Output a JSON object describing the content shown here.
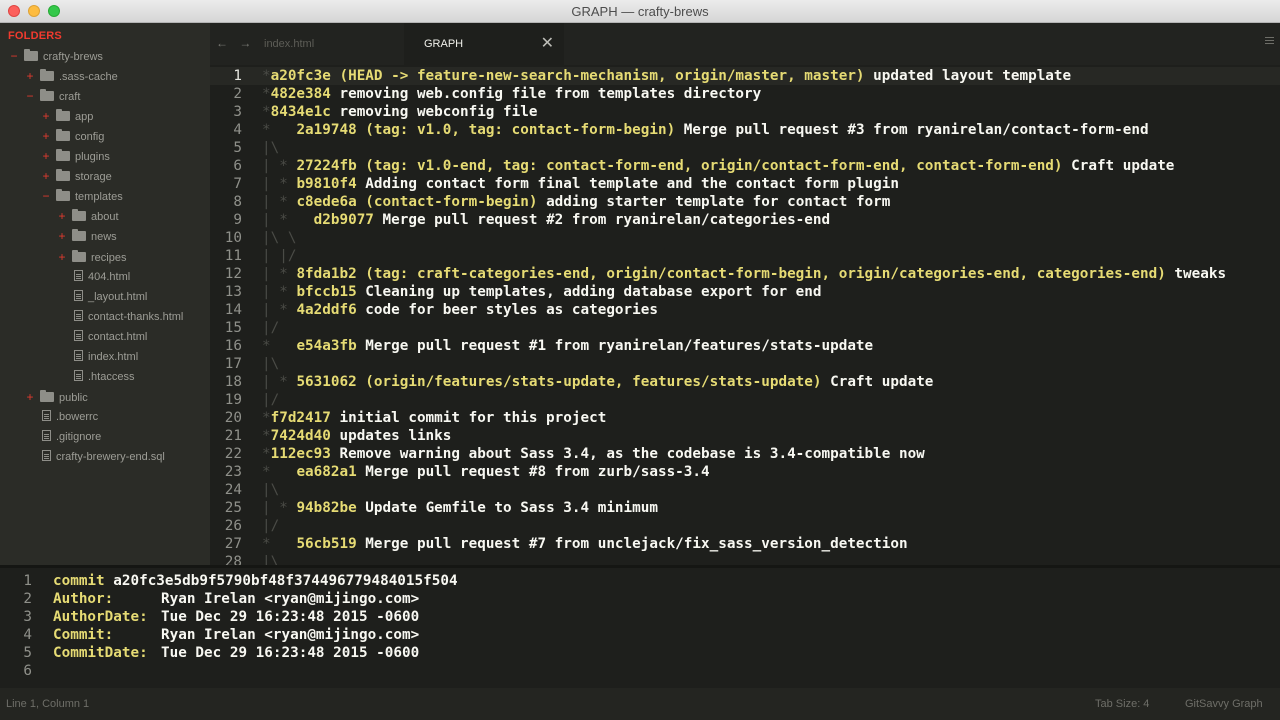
{
  "window": {
    "title": "GRAPH — crafty-brews"
  },
  "sidebar": {
    "header": "FOLDERS",
    "items": [
      {
        "label": "crafty-brews",
        "type": "folder",
        "toggle": "−",
        "depth": 0
      },
      {
        "label": ".sass-cache",
        "type": "folder",
        "toggle": "+",
        "depth": 1
      },
      {
        "label": "craft",
        "type": "folder",
        "toggle": "−",
        "depth": 1
      },
      {
        "label": "app",
        "type": "folder",
        "toggle": "+",
        "depth": 2
      },
      {
        "label": "config",
        "type": "folder",
        "toggle": "+",
        "depth": 2
      },
      {
        "label": "plugins",
        "type": "folder",
        "toggle": "+",
        "depth": 2
      },
      {
        "label": "storage",
        "type": "folder",
        "toggle": "+",
        "depth": 2
      },
      {
        "label": "templates",
        "type": "folder",
        "toggle": "−",
        "depth": 2
      },
      {
        "label": "about",
        "type": "folder",
        "toggle": "+",
        "depth": 3
      },
      {
        "label": "news",
        "type": "folder",
        "toggle": "+",
        "depth": 3
      },
      {
        "label": "recipes",
        "type": "folder",
        "toggle": "+",
        "depth": 3
      },
      {
        "label": "404.html",
        "type": "file",
        "toggle": "",
        "depth": 3
      },
      {
        "label": "_layout.html",
        "type": "file",
        "toggle": "",
        "depth": 3
      },
      {
        "label": "contact-thanks.html",
        "type": "file",
        "toggle": "",
        "depth": 3
      },
      {
        "label": "contact.html",
        "type": "file",
        "toggle": "",
        "depth": 3
      },
      {
        "label": "index.html",
        "type": "file",
        "toggle": "",
        "depth": 3
      },
      {
        "label": ".htaccess",
        "type": "file",
        "toggle": "",
        "depth": 3
      },
      {
        "label": "public",
        "type": "folder",
        "toggle": "+",
        "depth": 1
      },
      {
        "label": ".bowerrc",
        "type": "file",
        "toggle": "",
        "depth": 1
      },
      {
        "label": ".gitignore",
        "type": "file",
        "toggle": "",
        "depth": 1
      },
      {
        "label": "crafty-brewery-end.sql",
        "type": "file",
        "toggle": "",
        "depth": 1
      }
    ]
  },
  "tabs": {
    "nav_arrows": "← →",
    "items": [
      {
        "label": "index.html",
        "active": false
      },
      {
        "label": "GRAPH",
        "active": true
      }
    ],
    "close_glyph": "✕"
  },
  "editor": {
    "current_line": 1,
    "lines": [
      {
        "n": "1",
        "graph": "*",
        "hash": "a20fc3e",
        "refs": " (HEAD -> feature-new-search-mechanism, origin/master, master)",
        "msg": " updated layout template"
      },
      {
        "n": "2",
        "graph": "*",
        "hash": "482e384",
        "refs": "",
        "msg": " removing web.config file from templates directory"
      },
      {
        "n": "3",
        "graph": "*",
        "hash": "8434e1c",
        "refs": "",
        "msg": " removing webconfig file"
      },
      {
        "n": "4",
        "graph": "*   ",
        "hash": "2a19748",
        "refs": " (tag: v1.0, tag: contact-form-begin)",
        "msg": " Merge pull request #3 from ryanirelan/contact-form-end"
      },
      {
        "n": "5",
        "graph": "|\\",
        "hash": "",
        "refs": "",
        "msg": ""
      },
      {
        "n": "6",
        "graph": "| * ",
        "hash": "27224fb",
        "refs": " (tag: v1.0-end, tag: contact-form-end, origin/contact-form-end, contact-form-end)",
        "msg": " Craft update"
      },
      {
        "n": "7",
        "graph": "| * ",
        "hash": "b9810f4",
        "refs": "",
        "msg": " Adding contact form final template and the contact form plugin"
      },
      {
        "n": "8",
        "graph": "| * ",
        "hash": "c8ede6a",
        "refs": " (contact-form-begin)",
        "msg": " adding starter template for contact form"
      },
      {
        "n": "9",
        "graph": "| *   ",
        "hash": "d2b9077",
        "refs": "",
        "msg": " Merge pull request #2 from ryanirelan/categories-end"
      },
      {
        "n": "10",
        "graph": "|\\ \\",
        "hash": "",
        "refs": "",
        "msg": ""
      },
      {
        "n": "11",
        "graph": "| |/",
        "hash": "",
        "refs": "",
        "msg": ""
      },
      {
        "n": "12",
        "graph": "| * ",
        "hash": "8fda1b2",
        "refs": " (tag: craft-categories-end, origin/contact-form-begin, origin/categories-end, categories-end)",
        "msg": " tweaks"
      },
      {
        "n": "13",
        "graph": "| * ",
        "hash": "bfccb15",
        "refs": "",
        "msg": " Cleaning up templates, adding database export for end"
      },
      {
        "n": "14",
        "graph": "| * ",
        "hash": "4a2ddf6",
        "refs": "",
        "msg": " code for beer styles as categories"
      },
      {
        "n": "15",
        "graph": "|/",
        "hash": "",
        "refs": "",
        "msg": ""
      },
      {
        "n": "16",
        "graph": "*   ",
        "hash": "e54a3fb",
        "refs": "",
        "msg": " Merge pull request #1 from ryanirelan/features/stats-update"
      },
      {
        "n": "17",
        "graph": "|\\",
        "hash": "",
        "refs": "",
        "msg": ""
      },
      {
        "n": "18",
        "graph": "| * ",
        "hash": "5631062",
        "refs": " (origin/features/stats-update, features/stats-update)",
        "msg": " Craft update"
      },
      {
        "n": "19",
        "graph": "|/",
        "hash": "",
        "refs": "",
        "msg": ""
      },
      {
        "n": "20",
        "graph": "*",
        "hash": "f7d2417",
        "refs": "",
        "msg": " initial commit for this project"
      },
      {
        "n": "21",
        "graph": "*",
        "hash": "7424d40",
        "refs": "",
        "msg": " updates links"
      },
      {
        "n": "22",
        "graph": "*",
        "hash": "112ec93",
        "refs": "",
        "msg": " Remove warning about Sass 3.4, as the codebase is 3.4-compatible now"
      },
      {
        "n": "23",
        "graph": "*   ",
        "hash": "ea682a1",
        "refs": "",
        "msg": " Merge pull request #8 from zurb/sass-3.4"
      },
      {
        "n": "24",
        "graph": "|\\",
        "hash": "",
        "refs": "",
        "msg": ""
      },
      {
        "n": "25",
        "graph": "| * ",
        "hash": "94b82be",
        "refs": "",
        "msg": " Update Gemfile to Sass 3.4 minimum"
      },
      {
        "n": "26",
        "graph": "|/",
        "hash": "",
        "refs": "",
        "msg": ""
      },
      {
        "n": "27",
        "graph": "*   ",
        "hash": "56cb519",
        "refs": "",
        "msg": " Merge pull request #7 from unclejack/fix_sass_version_detection"
      },
      {
        "n": "28",
        "graph": "|\\",
        "hash": "",
        "refs": "",
        "msg": ""
      }
    ]
  },
  "commit_panel": {
    "lines": [
      {
        "n": "1",
        "key": "commit ",
        "val": "a20fc3e5db9f5790bf48f374496779484015f504",
        "full": true
      },
      {
        "n": "2",
        "key": "Author:",
        "val": "Ryan Irelan <ryan@mijingo.com>",
        "full": false
      },
      {
        "n": "3",
        "key": "AuthorDate:",
        "val": "Tue Dec 29 16:23:48 2015 -0600",
        "full": false
      },
      {
        "n": "4",
        "key": "Commit:",
        "val": "Ryan Irelan <ryan@mijingo.com>",
        "full": false
      },
      {
        "n": "5",
        "key": "CommitDate:",
        "val": "Tue Dec 29 16:23:48 2015 -0600",
        "full": false
      },
      {
        "n": "6",
        "key": "",
        "val": "",
        "full": false
      }
    ]
  },
  "statusbar": {
    "position": "Line 1, Column 1",
    "tab_size": "Tab Size: 4",
    "syntax": "GitSavvy Graph"
  }
}
